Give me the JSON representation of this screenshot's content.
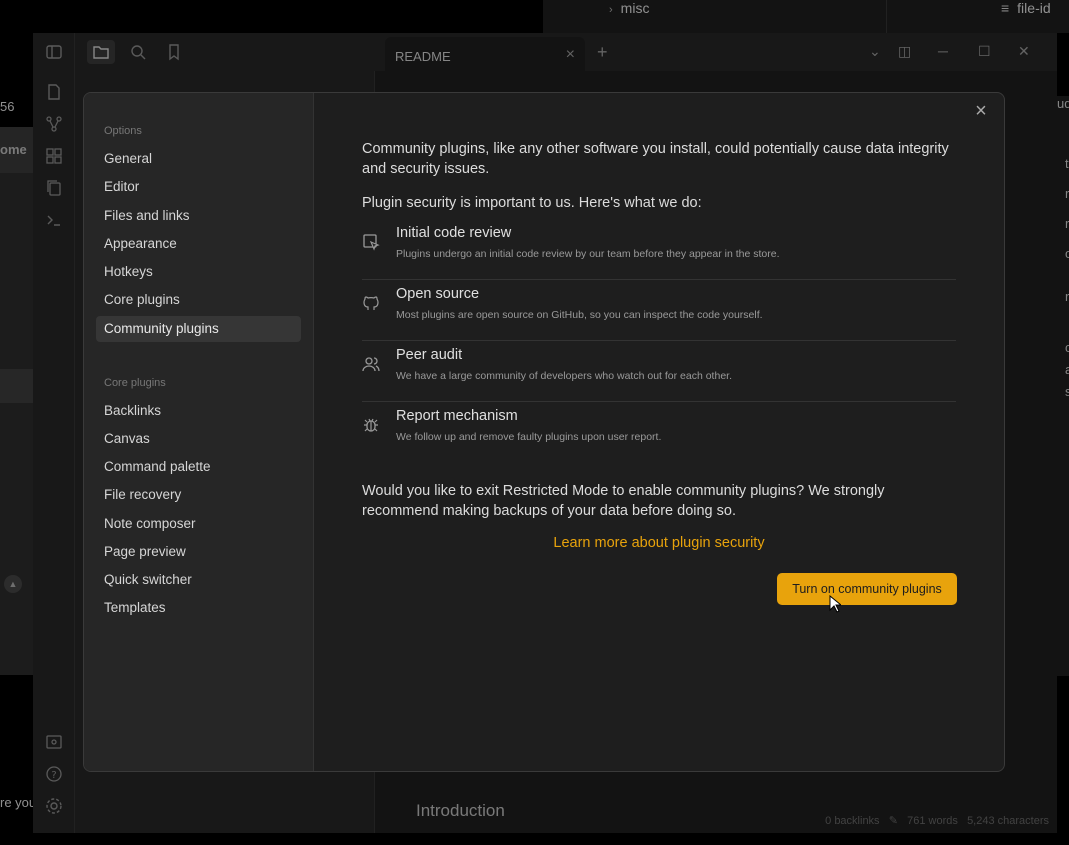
{
  "background": {
    "left_text_top": "56",
    "left_panel_header": "ome",
    "left_text_bottom": "re you",
    "tree_folder": "misc",
    "right_tab_title": "file-id",
    "right_edge_chars": [
      "ud",
      "t",
      "r",
      "r",
      "o",
      "r",
      "c",
      "a",
      "s"
    ]
  },
  "window": {
    "tab_title": "README",
    "tab_close": "×",
    "new_tab": "+",
    "controls": {
      "minimize": "─",
      "maximize": "☐",
      "close": "✕"
    },
    "editor_heading": "Introduction",
    "status": {
      "backlinks": "0 backlinks",
      "words": "761 words",
      "characters": "5,243 characters"
    }
  },
  "modal": {
    "close": "×",
    "nav": {
      "options_heading": "Options",
      "options": [
        "General",
        "Editor",
        "Files and links",
        "Appearance",
        "Hotkeys",
        "Core plugins",
        "Community plugins"
      ],
      "active": "Community plugins",
      "core_heading": "Core plugins",
      "core": [
        "Backlinks",
        "Canvas",
        "Command palette",
        "File recovery",
        "Note composer",
        "Page preview",
        "Quick switcher",
        "Templates"
      ]
    },
    "intro": "Community plugins, like any other software you install, could potentially cause data integrity and security issues.",
    "security_lead": "Plugin security is important to us. Here's what we do:",
    "features": [
      {
        "icon": "code-review-icon",
        "title": "Initial code review",
        "desc": "Plugins undergo an initial code review by our team before they appear in the store."
      },
      {
        "icon": "github-icon",
        "title": "Open source",
        "desc": "Most plugins are open source on GitHub, so you can inspect the code yourself."
      },
      {
        "icon": "users-icon",
        "title": "Peer audit",
        "desc": "We have a large community of developers who watch out for each other."
      },
      {
        "icon": "bug-icon",
        "title": "Report mechanism",
        "desc": "We follow up and remove faulty plugins upon user report."
      }
    ],
    "question": "Would you like to exit Restricted Mode to enable community plugins? We strongly recommend making backups of your data before doing so.",
    "learn_more": "Learn more about plugin security",
    "cta": "Turn on community plugins"
  },
  "colors": {
    "accent": "#e8a30c",
    "modal_bg": "#1e1e1e",
    "nav_bg": "#262626"
  }
}
